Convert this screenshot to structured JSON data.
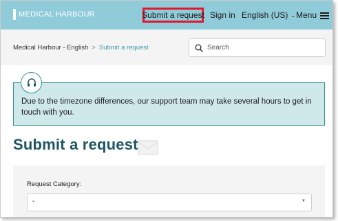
{
  "header": {
    "logo": "MEDICAL HARBOUR",
    "nav": {
      "submit_request": "Submit a request",
      "sign_in": "Sign in",
      "language": "English (US)",
      "menu": "Menu"
    }
  },
  "breadcrumb": {
    "home": "Medical Harbour - English",
    "separator": ">",
    "current": "Submit a request"
  },
  "search": {
    "placeholder": "Search"
  },
  "notice": {
    "text": "Due to the timezone differences, our support team may take several hours to get in touch with you.",
    "icon": "headset-icon"
  },
  "page": {
    "title": "Submit a request"
  },
  "form": {
    "category_label": "Request Category:",
    "category_value": "-"
  },
  "colors": {
    "header_bg": "#8fcbd9",
    "highlight_box": "#e3162b",
    "notice_bg": "#cfe8ea",
    "notice_border": "#2e8f9a",
    "title": "#1f5561",
    "link": "#3a9aa9"
  }
}
